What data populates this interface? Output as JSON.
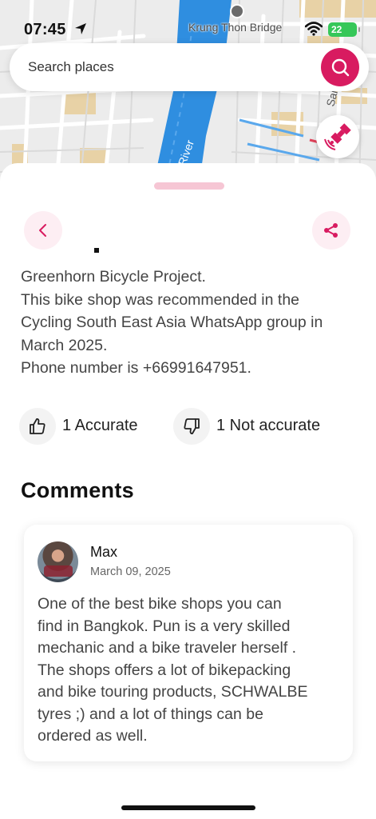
{
  "status_bar": {
    "time": "07:45",
    "battery": "22",
    "location_arrow_icon": "location-arrow-icon",
    "wifi_icon": "wifi-icon"
  },
  "map": {
    "bridge_label": "Krung Thon Bridge",
    "river_label": "River",
    "road_label": "Sai",
    "colors": {
      "land": "#ececec",
      "roads": "#ffffff",
      "water": "#2f8ee0",
      "parks": "#e8d2a6"
    }
  },
  "search": {
    "placeholder": "Search places",
    "button_icon": "search-icon",
    "accent": "#d81b60"
  },
  "satellite_button": {
    "icon": "satellite-icon"
  },
  "sheet": {
    "back_icon": "chevron-left-icon",
    "share_icon": "share-icon",
    "description_lines": [
      "Greenhorn Bicycle Project.",
      "This bike shop was recommended in the",
      "Cycling South East Asia WhatsApp group in",
      "March 2025.",
      "Phone number is +66991647951."
    ],
    "votes": {
      "accurate_label": "1 Accurate",
      "not_accurate_label": "1 Not accurate"
    },
    "comments_title": "Comments",
    "comments": [
      {
        "author": "Max",
        "date": "March 09, 2025",
        "text_lines": [
          "One of the best bike shops you can",
          "find in Bangkok. Pun is a very skilled",
          "mechanic and a bike traveler herself .",
          "The shops offers a lot of bikepacking",
          "and bike touring products, SCHWALBE",
          "tyres ;) and a lot of things can be",
          "ordered as well."
        ]
      }
    ]
  }
}
